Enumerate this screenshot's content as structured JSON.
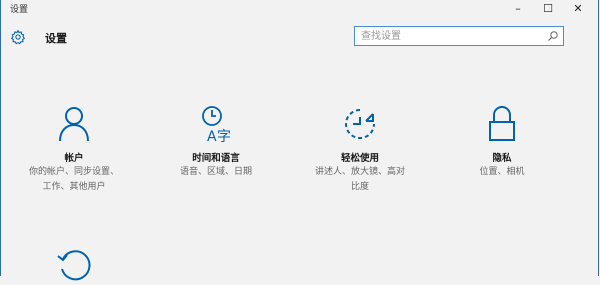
{
  "window": {
    "title": "设置",
    "minimize": "–",
    "maximize": "☐",
    "close": "✕"
  },
  "header": {
    "title": "设置",
    "icon": "gear-icon"
  },
  "search": {
    "placeholder": "查找设置",
    "value": ""
  },
  "colors": {
    "accent": "#0063b1",
    "border": "#2b6cb0",
    "background": "#f2f2f2"
  },
  "tiles": [
    {
      "icon": "person-icon",
      "label": "帐户",
      "desc_line1": "你的帐户、同步设置、",
      "desc_line2": "工作、其他用户"
    },
    {
      "icon": "time-language-icon",
      "label": "时间和语言",
      "desc_line1": "语音、区域、日期",
      "desc_line2": ""
    },
    {
      "icon": "ease-of-access-icon",
      "label": "轻松使用",
      "desc_line1": "讲述人、放大镜、高对",
      "desc_line2": "比度"
    },
    {
      "icon": "lock-icon",
      "label": "隐私",
      "desc_line1": "位置、相机",
      "desc_line2": ""
    },
    {
      "icon": "update-icon",
      "label": "",
      "desc_line1": "",
      "desc_line2": ""
    }
  ]
}
